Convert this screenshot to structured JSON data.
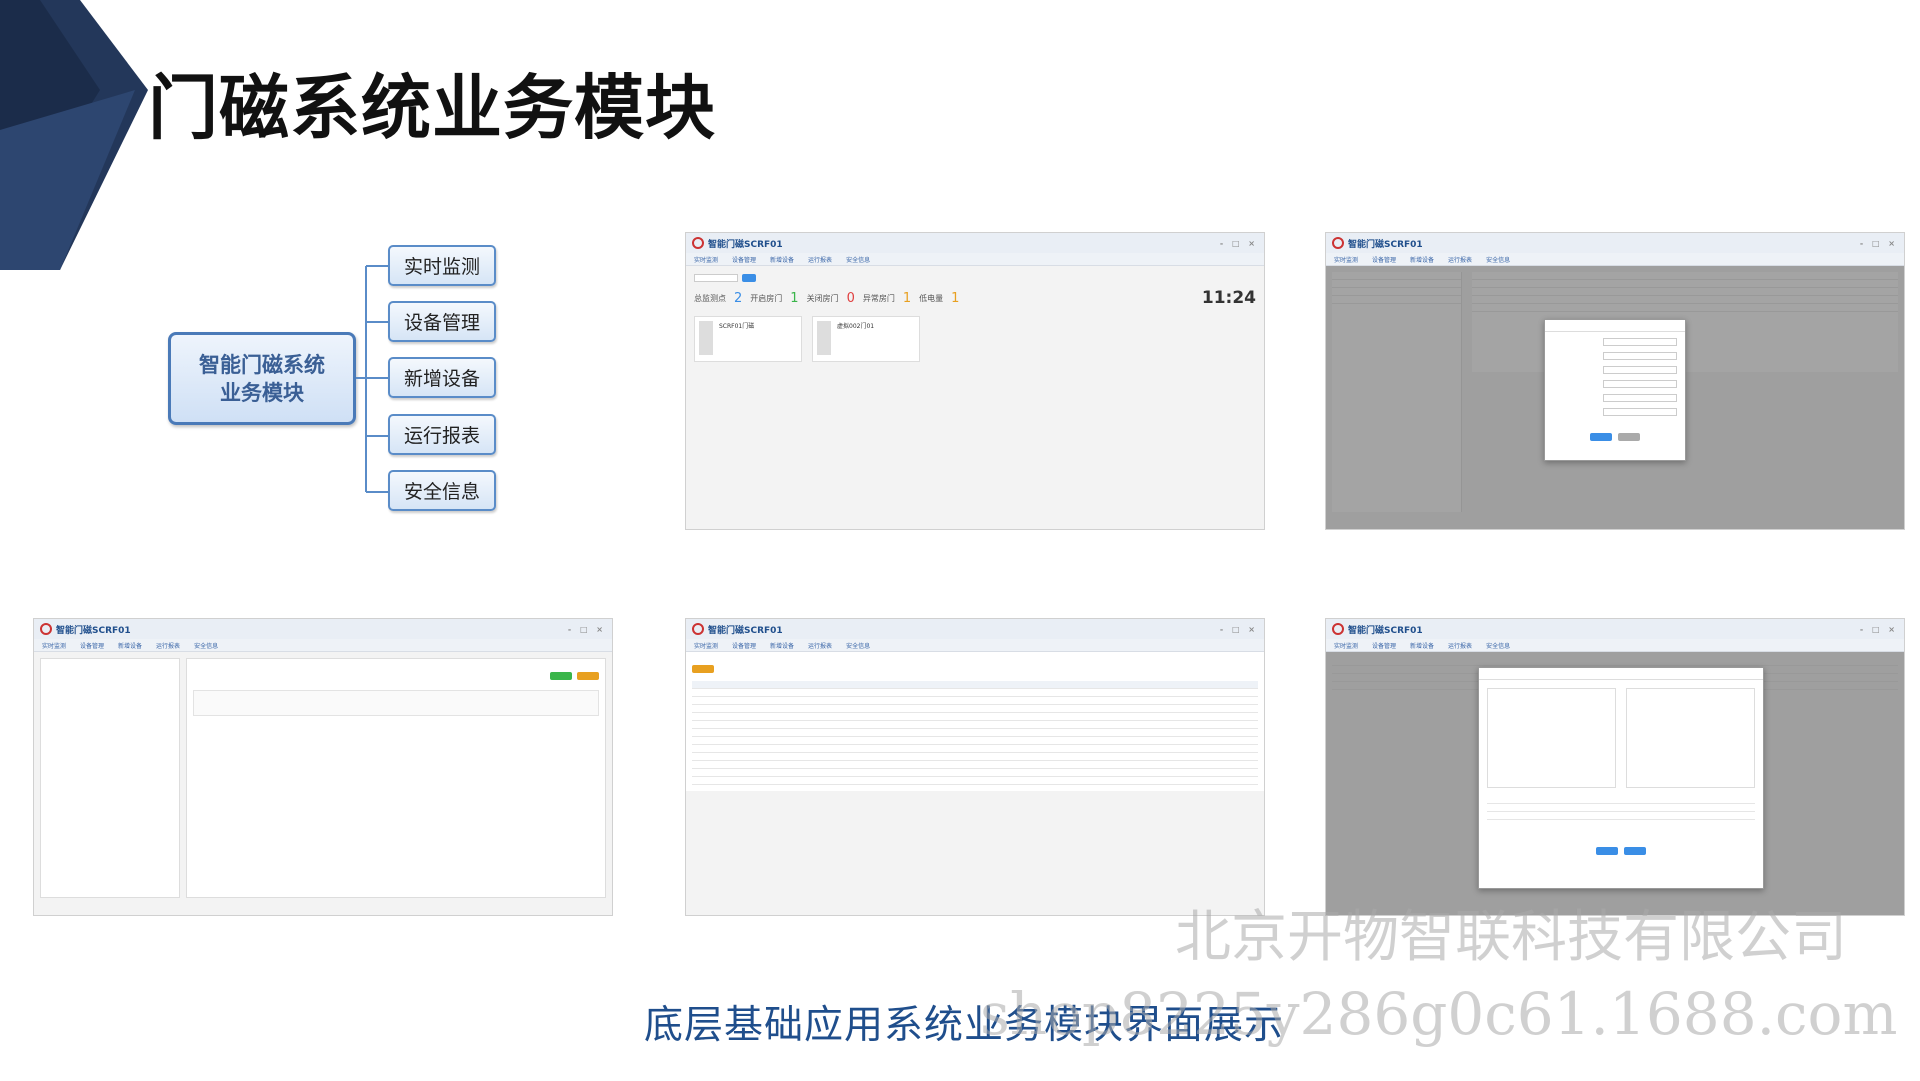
{
  "page": {
    "title": "门磁系统业务模块",
    "caption": "底层基础应用系统业务模块界面展示"
  },
  "mindmap": {
    "center_line1": "智能门磁系统",
    "center_line2": "业务模块",
    "branches": [
      "实时监测",
      "设备管理",
      "新增设备",
      "运行报表",
      "安全信息"
    ]
  },
  "app": {
    "title": "智能门磁SCRF01",
    "menu": [
      "实时监测",
      "设备管理",
      "新增设备",
      "运行报表",
      "安全信息"
    ]
  },
  "monitor": {
    "stats": [
      {
        "label": "总监测点",
        "value": "2"
      },
      {
        "label": "开启房门",
        "value": "1"
      },
      {
        "label": "关闭房门",
        "value": "0"
      },
      {
        "label": "异常房门",
        "value": "1"
      },
      {
        "label": "低电量",
        "value": "1"
      }
    ],
    "clock": "11:24",
    "devices": [
      "SCRF01门磁",
      "虚拟002门01"
    ]
  },
  "watermark": {
    "line1": "北京开物智联科技有限公司",
    "line2": "shop8225y286g0c61.1688.com"
  },
  "colors": {
    "brand_blue": "#1f4e8c",
    "mindmap_border": "#4a7ab8",
    "corner_dark": "#1e3050"
  }
}
